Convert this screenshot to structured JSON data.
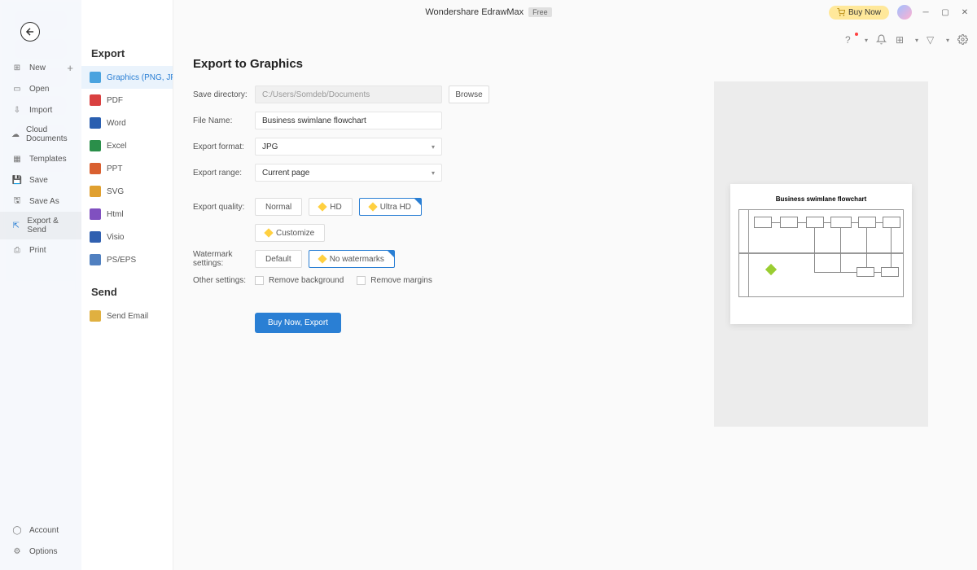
{
  "titlebar": {
    "app_name": "Wondershare EdrawMax",
    "badge": "Free",
    "buy_now": "Buy Now"
  },
  "left_nav": {
    "items": [
      {
        "icon": "plus",
        "label": "New",
        "has_plus": true
      },
      {
        "icon": "folder",
        "label": "Open"
      },
      {
        "icon": "import",
        "label": "Import"
      },
      {
        "icon": "cloud",
        "label": "Cloud Documents"
      },
      {
        "icon": "templates",
        "label": "Templates"
      },
      {
        "icon": "save",
        "label": "Save"
      },
      {
        "icon": "saveas",
        "label": "Save As"
      },
      {
        "icon": "export",
        "label": "Export & Send",
        "selected": true
      },
      {
        "icon": "print",
        "label": "Print"
      }
    ],
    "bottom": [
      {
        "icon": "account",
        "label": "Account"
      },
      {
        "icon": "gear",
        "label": "Options"
      }
    ]
  },
  "mid_nav": {
    "header_export": "Export",
    "export_items": [
      {
        "label": "Graphics (PNG, JPG e...",
        "selected": true,
        "color": "#4aa3df"
      },
      {
        "label": "PDF",
        "color": "#d94040"
      },
      {
        "label": "Word",
        "color": "#2a5fb0"
      },
      {
        "label": "Excel",
        "color": "#2a8f4a"
      },
      {
        "label": "PPT",
        "color": "#d96030"
      },
      {
        "label": "SVG",
        "color": "#e0a030"
      },
      {
        "label": "Html",
        "color": "#8050c0"
      },
      {
        "label": "Visio",
        "color": "#3060b0"
      },
      {
        "label": "PS/EPS",
        "color": "#5080c0"
      }
    ],
    "header_send": "Send",
    "send_items": [
      {
        "label": "Send Email",
        "color": "#e0b040"
      }
    ]
  },
  "main": {
    "title": "Export to Graphics",
    "save_dir_label": "Save directory:",
    "save_dir_value": "C:/Users/Somdeb/Documents",
    "browse": "Browse",
    "filename_label": "File Name:",
    "filename_value": "Business swimlane flowchart",
    "format_label": "Export format:",
    "format_value": "JPG",
    "range_label": "Export range:",
    "range_value": "Current page",
    "quality_label": "Export quality:",
    "quality_normal": "Normal",
    "quality_hd": "HD",
    "quality_ultra": "Ultra HD",
    "quality_customize": "Customize",
    "watermark_label": "Watermark settings:",
    "watermark_default": "Default",
    "watermark_none": "No watermarks",
    "other_label": "Other settings:",
    "remove_bg": "Remove background",
    "remove_margins": "Remove margins",
    "export_btn": "Buy Now, Export"
  },
  "preview": {
    "title": "Business swimlane flowchart"
  }
}
